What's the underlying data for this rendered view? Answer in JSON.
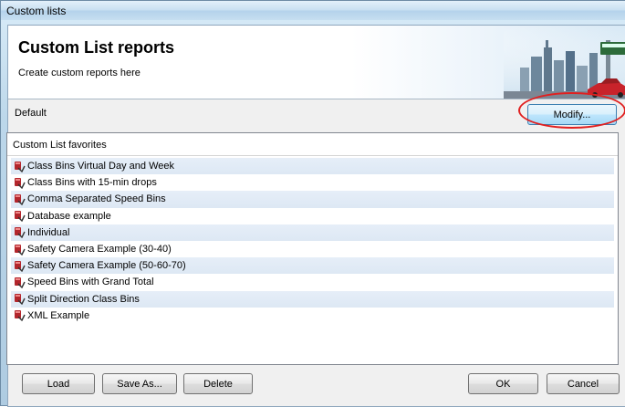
{
  "window": {
    "title": "Custom lists"
  },
  "header": {
    "title": "Custom List reports",
    "subtitle": "Create custom reports here"
  },
  "default_bar": {
    "label": "Default",
    "modify_label": "Modify..."
  },
  "list": {
    "header": "Custom List favorites",
    "icon": "report-arrow-icon",
    "items": [
      "Class Bins Virtual Day and Week",
      "Class Bins with 15-min drops",
      "Comma Separated Speed Bins",
      "Database example",
      "Individual",
      "Safety Camera Example (30-40)",
      "Safety Camera Example (50-60-70)",
      "Speed Bins with Grand Total",
      "Split Direction Class Bins",
      "XML Example"
    ]
  },
  "buttons": {
    "load": "Load",
    "save_as": "Save As...",
    "delete": "Delete",
    "ok": "OK",
    "cancel": "Cancel"
  },
  "colors": {
    "highlight": "#e02020",
    "alt_row": "#e6eef8"
  }
}
